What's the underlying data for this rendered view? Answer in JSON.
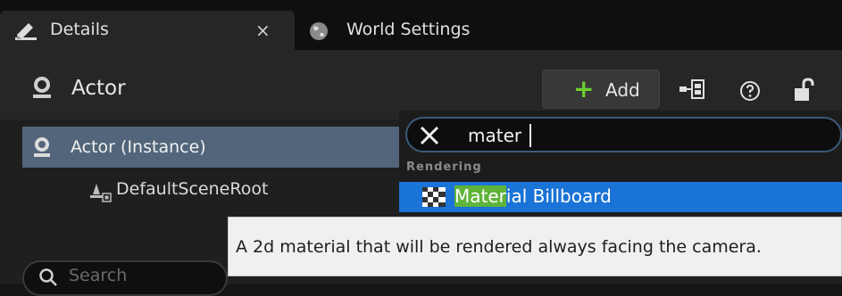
{
  "tabs": [
    {
      "label": "Details",
      "close": "×"
    },
    {
      "label": "World Settings"
    }
  ],
  "header": {
    "actor_title": "Actor",
    "add_label": "Add",
    "add_symbol": "+"
  },
  "tree": {
    "items": [
      {
        "label": "Actor (Instance)"
      },
      {
        "label": "DefaultSceneRoot"
      }
    ]
  },
  "search": {
    "placeholder": "Search"
  },
  "dropdown": {
    "filter_value": "mater",
    "category": "Rendering",
    "item": {
      "match": "Mater",
      "rest": "ial Billboard"
    }
  },
  "tooltip": {
    "text": "A 2d material that will be rendered always facing the camera."
  },
  "colors": {
    "selected_row": "#52657a",
    "dropdown_selection": "#1a73d6",
    "match_highlight": "#5fb43a",
    "add_plus": "#6fcf33"
  }
}
